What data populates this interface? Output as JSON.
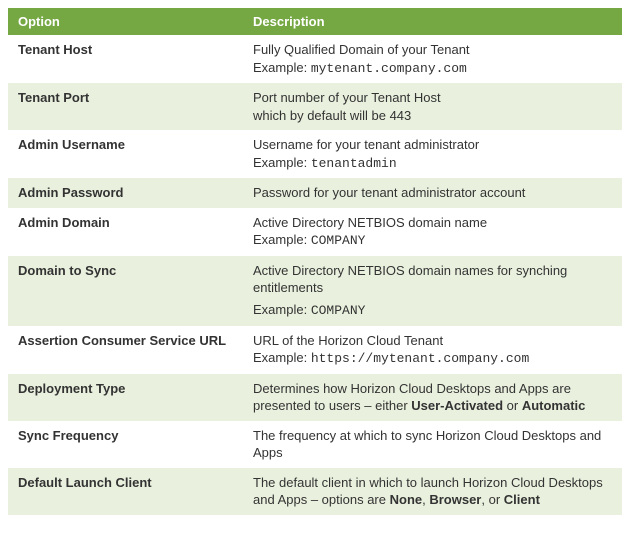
{
  "headers": {
    "option": "Option",
    "description": "Description"
  },
  "rows": [
    {
      "option": "Tenant Host",
      "desc": [
        {
          "text": "Fully Qualified Domain of your Tenant"
        },
        {
          "prefix": "Example: ",
          "code": "mytenant.company.com"
        }
      ]
    },
    {
      "option": "Tenant Port",
      "desc": [
        {
          "text": "Port number of your Tenant Host"
        },
        {
          "text": "which by default will be 443"
        }
      ]
    },
    {
      "option": "Admin Username",
      "desc": [
        {
          "text": "Username for your tenant administrator"
        },
        {
          "prefix": "Example: ",
          "code": "tenantadmin"
        }
      ]
    },
    {
      "option": "Admin Password",
      "desc": [
        {
          "text": "Password for your tenant administrator account"
        }
      ]
    },
    {
      "option": "Admin Domain",
      "desc": [
        {
          "text": "Active Directory NETBIOS domain name"
        },
        {
          "prefix": "Example: ",
          "code": "COMPANY"
        }
      ]
    },
    {
      "option": "Domain to Sync",
      "desc": [
        {
          "text": "Active Directory NETBIOS domain names for synching entitlements"
        },
        {
          "prefix": "Example: ",
          "code": "COMPANY",
          "gap": true
        }
      ]
    },
    {
      "option": "Assertion Consumer Service URL",
      "desc": [
        {
          "text": "URL of the Horizon Cloud Tenant"
        },
        {
          "prefix": "Example: ",
          "code": "https://mytenant.company.com"
        }
      ]
    },
    {
      "option": "Deployment Type",
      "desc": [
        {
          "rich": [
            {
              "t": "Determines how Horizon Cloud Desktops and Apps are presented to users – either "
            },
            {
              "t": "User-Activated",
              "b": true
            },
            {
              "t": " or "
            },
            {
              "t": "Automatic",
              "b": true
            }
          ]
        }
      ]
    },
    {
      "option": "Sync Frequency",
      "desc": [
        {
          "text": "The frequency at which to sync Horizon Cloud Desktops and Apps"
        }
      ]
    },
    {
      "option": "Default Launch Client",
      "desc": [
        {
          "rich": [
            {
              "t": "The default client in which to launch Horizon Cloud Desktops and Apps – options are "
            },
            {
              "t": "None",
              "b": true
            },
            {
              "t": ", "
            },
            {
              "t": "Browser",
              "b": true
            },
            {
              "t": ", or "
            },
            {
              "t": "Client",
              "b": true
            }
          ]
        }
      ]
    }
  ]
}
